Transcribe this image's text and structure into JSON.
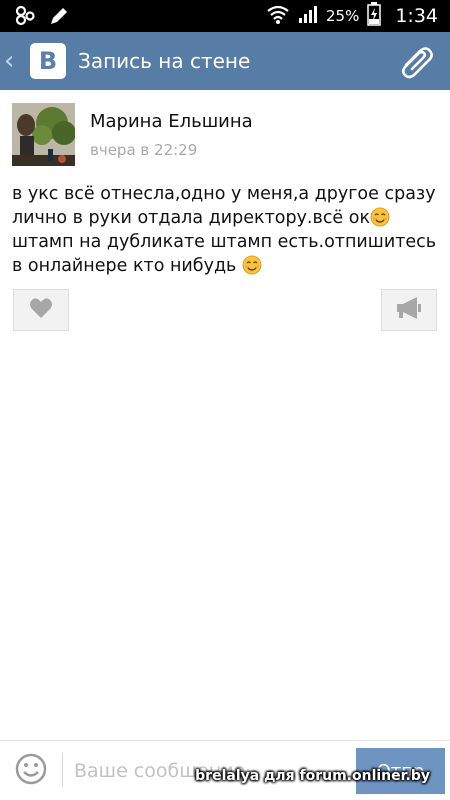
{
  "status_bar": {
    "battery_percent": "25%",
    "time": "1:34",
    "icons": [
      "notification-icon",
      "edit-icon",
      "wifi-icon",
      "signal-icon",
      "battery-charging-icon"
    ]
  },
  "header": {
    "logo_letter": "В",
    "title": "Запись на стене",
    "icons": [
      "back-chevron-icon",
      "vk-logo-icon",
      "paperclip-icon"
    ],
    "background": "#577ca6"
  },
  "post": {
    "author": "Марина Ельшина",
    "time": "вчера в 22:29",
    "text_part1": "в укс  всё отнесла,одно у меня,а другое сразу лично в руки отдала директору.всё ок",
    "text_part2": " штамп на дубликате штамп есть.отпишитесь в онлайнере кто нибудь ",
    "icons": [
      "smiley-emoji-icon",
      "heart-icon",
      "megaphone-icon"
    ]
  },
  "composer": {
    "placeholder": "Ваше сообщение",
    "send_label": "Отпр",
    "send_color": "#6e94c2"
  },
  "watermark": "brelalya для forum.onliner.by"
}
